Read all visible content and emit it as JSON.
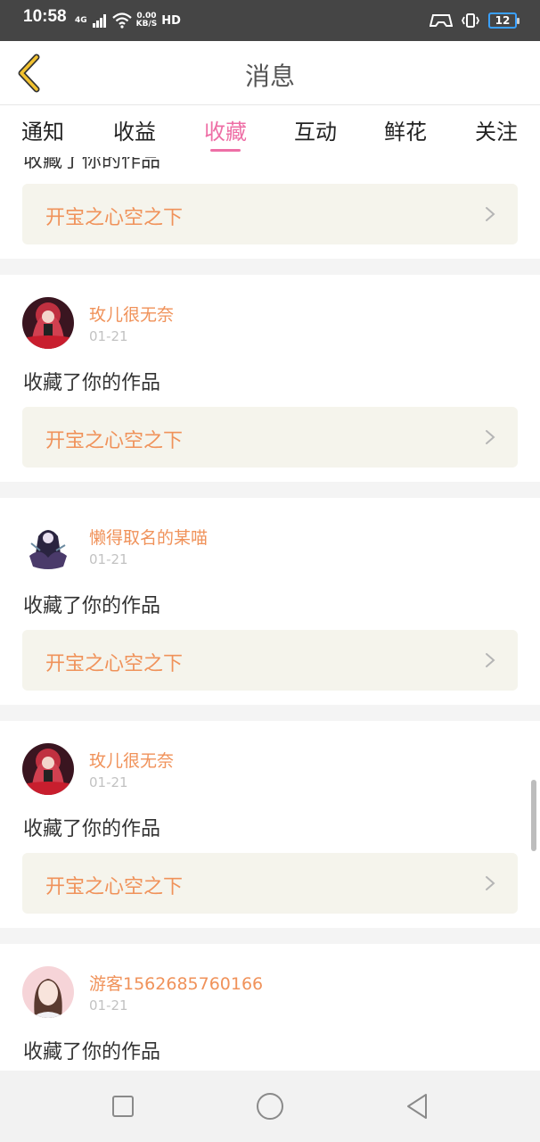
{
  "status_bar": {
    "time": "10:58",
    "network_type": "4G",
    "speed_value": "0.00",
    "speed_unit": "KB/S",
    "hd_label": "HD",
    "battery_level": "12",
    "accent_color": "#3aa0ff"
  },
  "header": {
    "title": "消息",
    "back_icon": "chevron-left-icon"
  },
  "tabs": [
    {
      "label": "通知",
      "active": false
    },
    {
      "label": "收益",
      "active": false
    },
    {
      "label": "收藏",
      "active": true
    },
    {
      "label": "互动",
      "active": false
    },
    {
      "label": "鲜花",
      "active": false
    },
    {
      "label": "关注",
      "active": false
    }
  ],
  "colors": {
    "active_tab": "#ee6fa6",
    "username": "#f0925a",
    "work_title": "#f0925a",
    "work_box_bg": "#f5f4ec",
    "date": "#c2c2c2",
    "separator": "#f4f4f4"
  },
  "feed": {
    "partial_top": {
      "action": "收藏了你的作品",
      "work_title": "开宝之心空之下"
    },
    "items": [
      {
        "username": "玫儿很无奈",
        "date": "01-21",
        "action": "收藏了你的作品",
        "work_title": "开宝之心空之下",
        "avatar": "anime-girl-red-avatar"
      },
      {
        "username": "懒得取名的某喵",
        "date": "01-21",
        "action": "收藏了你的作品",
        "work_title": "开宝之心空之下",
        "avatar": "dark-cloaked-figure-avatar"
      },
      {
        "username": "玫儿很无奈",
        "date": "01-21",
        "action": "收藏了你的作品",
        "work_title": "开宝之心空之下",
        "avatar": "anime-girl-red-avatar"
      },
      {
        "username": "游客1562685760166",
        "date": "01-21",
        "action": "收藏了你的作品",
        "work_title": "",
        "avatar": "pink-portrait-avatar"
      }
    ]
  },
  "navbar": {
    "buttons": [
      "recents-square-icon",
      "home-circle-icon",
      "back-triangle-icon"
    ]
  }
}
